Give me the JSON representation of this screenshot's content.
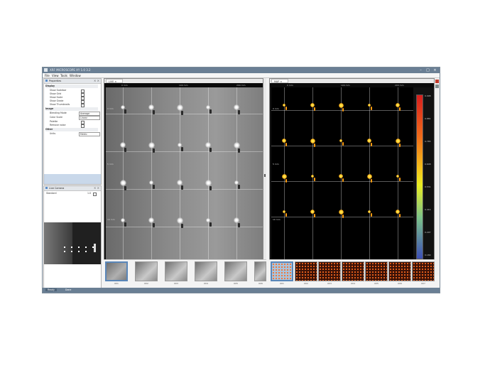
{
  "window": {
    "title": "XRF MICROSCOPE XY 1.0 3.2"
  },
  "menu": [
    {
      "label": "File"
    },
    {
      "label": "View"
    },
    {
      "label": "Tools"
    },
    {
      "label": "Window"
    }
  ],
  "properties": {
    "title": "Properties",
    "sections": [
      {
        "label": "Display",
        "rows": [
          {
            "label": "Show Scalebar",
            "checked": true
          },
          {
            "label": "Show Grid",
            "checked": true
          },
          {
            "label": "Show Scale",
            "checked": true
          },
          {
            "label": "Show Grade",
            "checked": true
          },
          {
            "label": "Show Thumbnails",
            "checked": true
          }
        ]
      },
      {
        "label": "Image",
        "rows": [
          {
            "label": "Blending Mode",
            "value": "Average"
          },
          {
            "label": "Color Scale",
            "value": "Linear"
          },
          {
            "label": "Palette",
            "checked": true
          },
          {
            "label": "Remove noise",
            "checked": true
          }
        ]
      },
      {
        "label": "Other",
        "rows": [
          {
            "label": "Units",
            "value": "Metric"
          }
        ]
      }
    ]
  },
  "ortho": {
    "title": "Live Camera",
    "label": "Standard",
    "value": "1.0"
  },
  "viewer_left": {
    "tab": "LIVE",
    "ruler": [
      "0 mm",
      "100 mm",
      "200 mm"
    ],
    "side": [
      "0 mm",
      "5 mm",
      "10 mm"
    ],
    "scale": "5.0 mm",
    "thumbs": [
      "001",
      "002",
      "003",
      "004",
      "005",
      "006"
    ]
  },
  "viewer_right": {
    "tab": "MAP",
    "ruler": [
      "0 mm",
      "100 mm",
      "200 mm"
    ],
    "side": [
      "0 mm",
      "5 mm",
      "10 mm"
    ],
    "scale": "5.0 mm",
    "colorbar_ticks": [
      "0.998",
      "0.881",
      "0.765",
      "0.648",
      "0.531",
      "0.414",
      "0.297",
      "0.180"
    ],
    "thumbs": [
      "001",
      "002",
      "003",
      "004",
      "005",
      "006",
      "007"
    ]
  },
  "status": {
    "left": "Ready",
    "right": "Done"
  }
}
